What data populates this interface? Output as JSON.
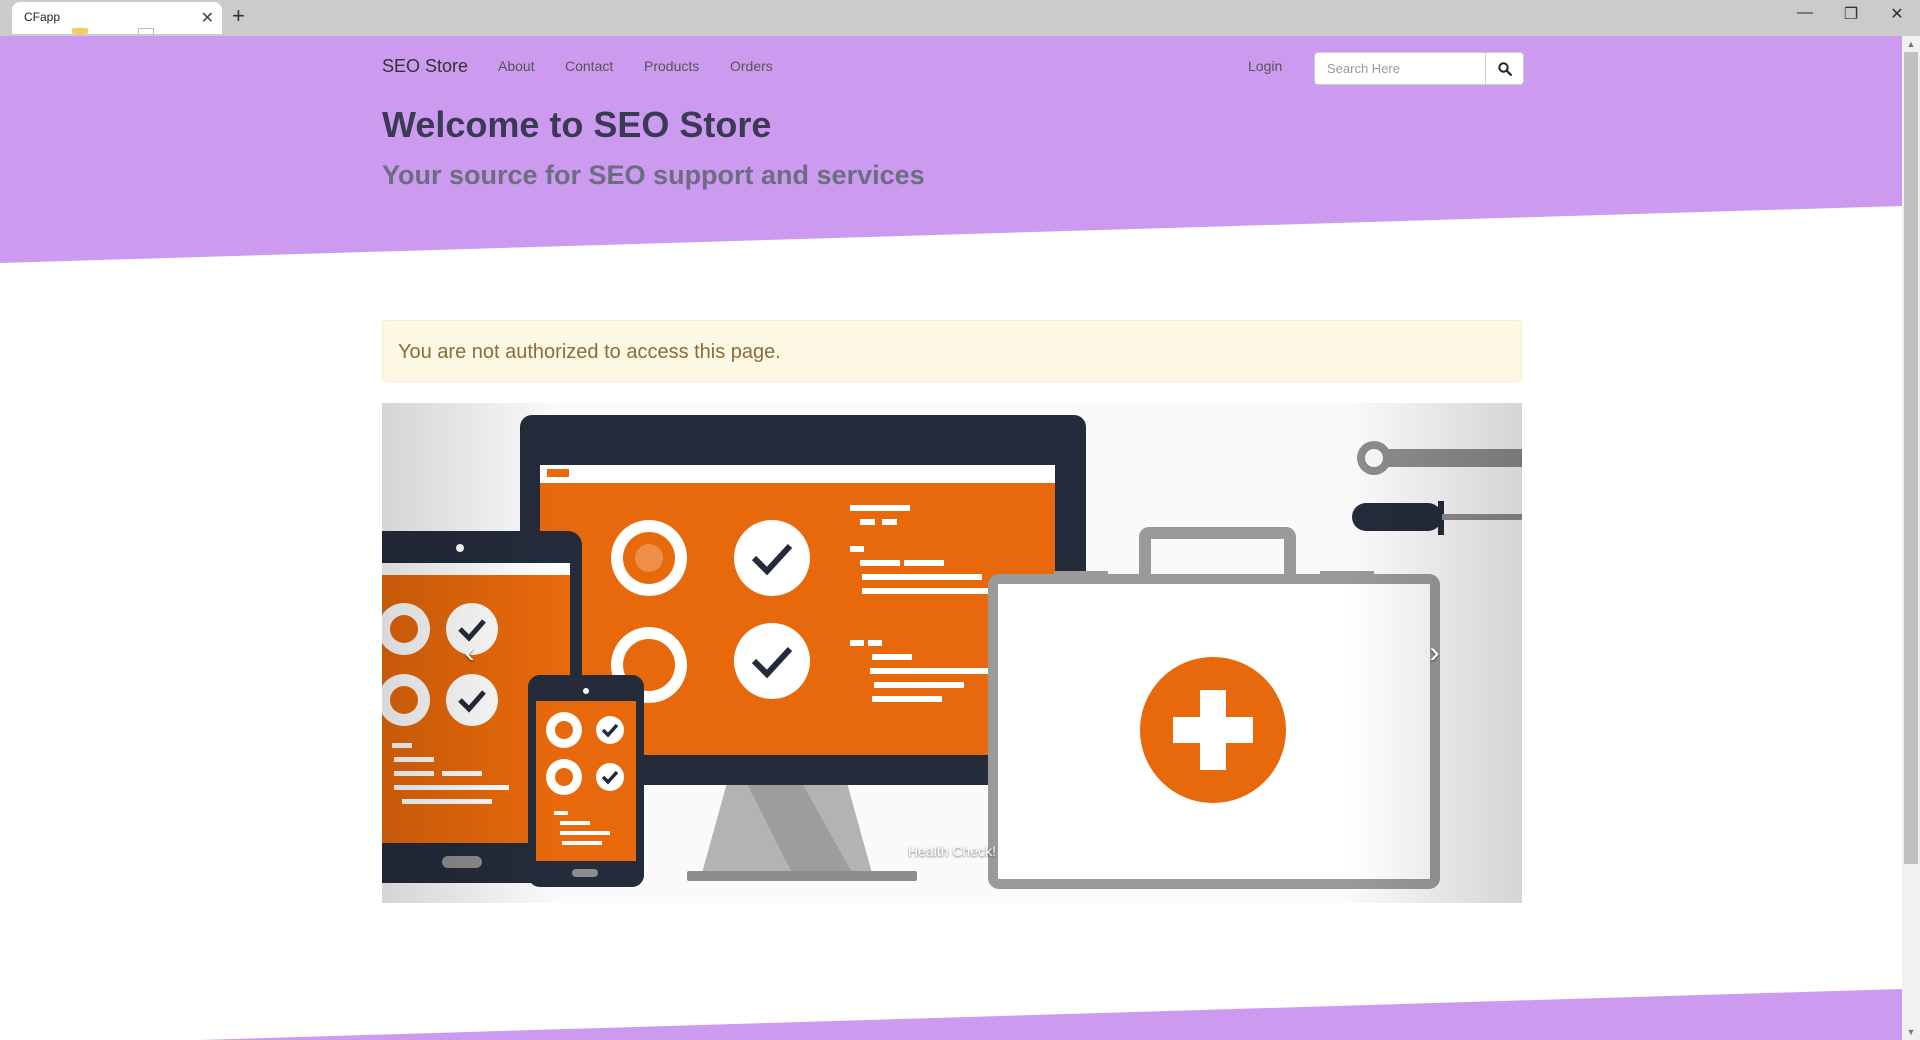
{
  "browser": {
    "tab_title": "CFapp",
    "tab_close": "✕",
    "new_tab": "+",
    "minimize": "—",
    "restore": "❐",
    "close": "✕"
  },
  "navbar": {
    "brand": "SEO Store",
    "links": [
      "About",
      "Contact",
      "Products",
      "Orders"
    ],
    "login": "Login",
    "search_placeholder": "Search Here"
  },
  "hero": {
    "title": "Welcome to SEO Store",
    "subtitle": "Your source for SEO support and services"
  },
  "alert": {
    "message": "You are not authorized to access this page."
  },
  "carousel": {
    "caption": "Health Check!",
    "prev": "‹",
    "next": "›"
  },
  "colors": {
    "accent": "#cc9aef",
    "orange": "#e8690b",
    "navy": "#242b3a"
  }
}
